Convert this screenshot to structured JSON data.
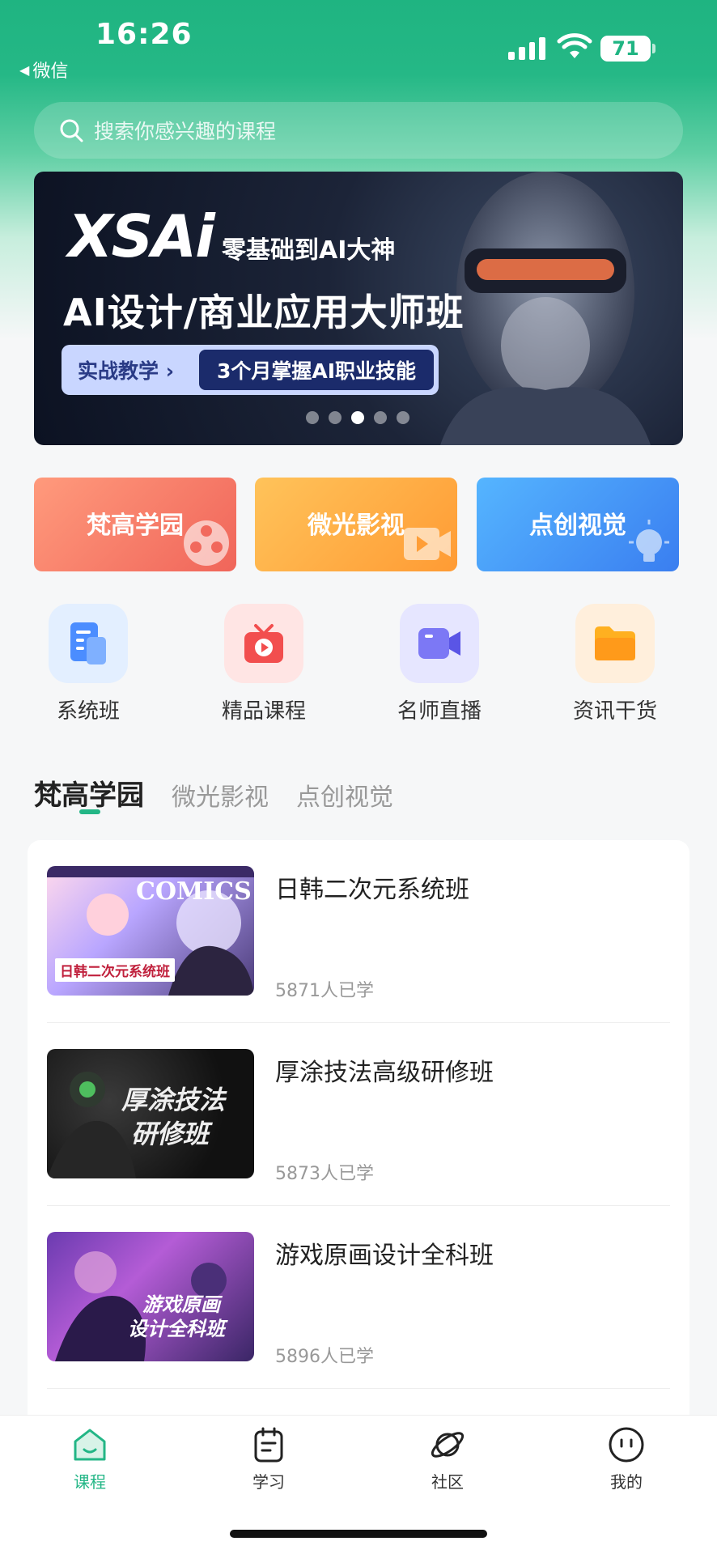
{
  "status_bar": {
    "time": "16:26",
    "back_app": "微信",
    "battery": "71"
  },
  "search": {
    "placeholder": "搜索你感兴趣的课程"
  },
  "banner": {
    "logo": "XSAi",
    "slogan": "零基础到AI大神",
    "title": "AI设计/商业应用大师班",
    "pill_left": "实战教学 ›",
    "pill_right": "3个月掌握AI职业技能",
    "dots": 5,
    "active_dot": 2
  },
  "category_cards": [
    {
      "label": "梵高学园",
      "color": "#f0655a"
    },
    {
      "label": "微光影视",
      "color": "#ff9b34"
    },
    {
      "label": "点创视觉",
      "color": "#3a7ef0"
    }
  ],
  "quick_nav": [
    {
      "label": "系统班",
      "icon": "document-icon"
    },
    {
      "label": "精品课程",
      "icon": "tv-play-icon"
    },
    {
      "label": "名师直播",
      "icon": "video-camera-icon"
    },
    {
      "label": "资讯干货",
      "icon": "folder-icon"
    }
  ],
  "tabs": [
    {
      "label": "梵高学园",
      "active": true
    },
    {
      "label": "微光影视",
      "active": false
    },
    {
      "label": "点创视觉",
      "active": false
    }
  ],
  "courses": [
    {
      "title": "日韩二次元系统班",
      "learners": "5871人已学",
      "thumb_text": "日韩二次元系统班",
      "thumb_top": "COMICS"
    },
    {
      "title": "厚涂技法高级研修班",
      "learners": "5873人已学",
      "thumb_text": "厚涂技法",
      "thumb_text2": "研修班"
    },
    {
      "title": "游戏原画设计全科班",
      "learners": "5896人已学",
      "thumb_text": "游戏原画",
      "thumb_text2": "设计全科班"
    }
  ],
  "bottom_nav": [
    {
      "label": "课程",
      "active": true
    },
    {
      "label": "学习",
      "active": false
    },
    {
      "label": "社区",
      "active": false
    },
    {
      "label": "我的",
      "active": false
    }
  ],
  "accent_color": "#23b686"
}
